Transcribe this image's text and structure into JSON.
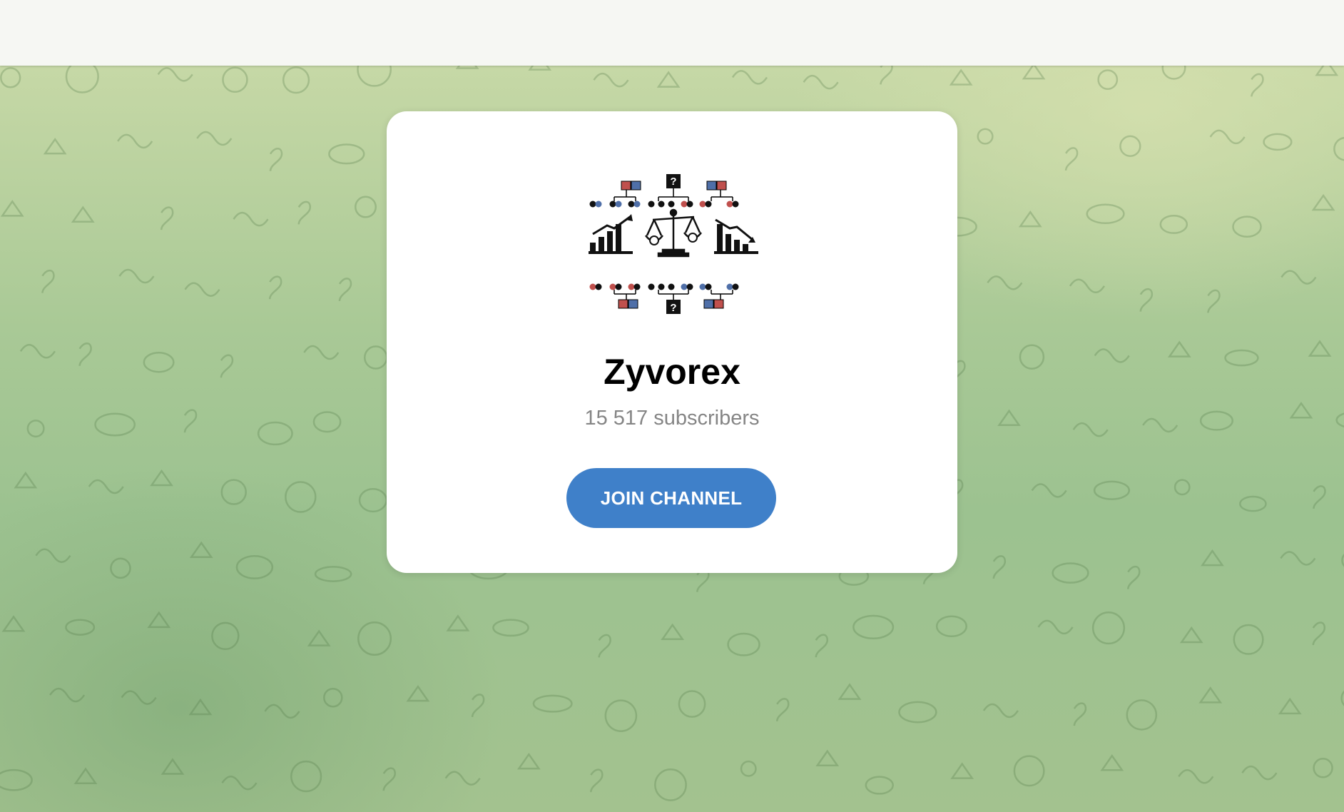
{
  "channel": {
    "name": "Zyvorex",
    "subscribers": "15 517 subscribers",
    "join_label": "JOIN CHANNEL",
    "logo_icon": "balance-scale-charts-logo",
    "logo_question_mark": "?"
  },
  "colors": {
    "top_bar": "#f6f7f3",
    "background_green": "#a9c996",
    "card": "#ffffff",
    "button": "#3f80c9",
    "subscribers_text": "#858585",
    "logo_red": "#c0504d",
    "logo_blue": "#4f6fa8"
  }
}
